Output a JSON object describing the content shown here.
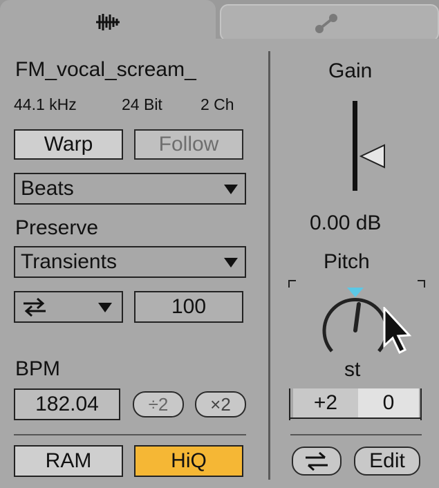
{
  "tabs": [
    {
      "icon": "waveform-icon",
      "active": true
    },
    {
      "icon": "envelope-node-icon",
      "active": false
    }
  ],
  "clip": {
    "name": "FM_vocal_scream_",
    "sample_rate": "44.1 kHz",
    "bit_depth": "24 Bit",
    "channels": "2 Ch"
  },
  "warp": {
    "warp_label": "Warp",
    "follow_label": "Follow",
    "mode_value": "Beats",
    "preserve_label": "Preserve",
    "preserve_value": "Transients",
    "loop_value": "100"
  },
  "bpm": {
    "label": "BPM",
    "value": "182.04",
    "half_label": "÷2",
    "double_label": "×2"
  },
  "bottom": {
    "ram_label": "RAM",
    "hiq_label": "HiQ"
  },
  "gain": {
    "label": "Gain",
    "value": "0.00 dB"
  },
  "pitch": {
    "label": "Pitch",
    "unit": "st",
    "semitones": "+2",
    "cents": "0"
  },
  "actions": {
    "edit_label": "Edit"
  },
  "colors": {
    "accent": "#f5b735",
    "knob_indicator": "#5bc8e6"
  }
}
